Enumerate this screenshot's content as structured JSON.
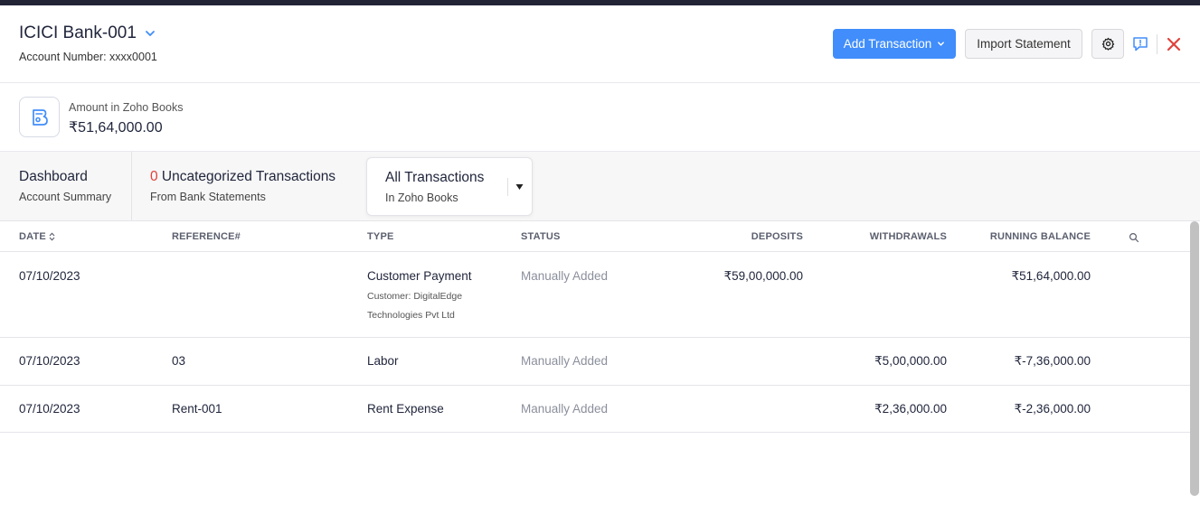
{
  "header": {
    "account_name": "ICICI Bank-001",
    "account_number": "Account Number: xxxx0001",
    "add_transaction_label": "Add Transaction",
    "import_statement_label": "Import Statement"
  },
  "amount": {
    "label": "Amount in Zoho Books",
    "value": "₹51,64,000.00"
  },
  "tabs": {
    "dashboard": {
      "title": "Dashboard",
      "subtitle": "Account Summary"
    },
    "uncategorized": {
      "count": "0",
      "title": " Uncategorized Transactions",
      "subtitle": "From Bank Statements"
    },
    "all": {
      "title": "All Transactions",
      "subtitle": "In Zoho Books"
    }
  },
  "table": {
    "columns": {
      "date": "DATE",
      "reference": "REFERENCE#",
      "type": "TYPE",
      "status": "STATUS",
      "deposits": "DEPOSITS",
      "withdrawals": "WITHDRAWALS",
      "running_balance": "RUNNING BALANCE"
    },
    "rows": [
      {
        "date": "07/10/2023",
        "reference": "",
        "type": "Customer Payment",
        "detail_line1": "Customer: DigitalEdge",
        "detail_line2": "Technologies Pvt Ltd",
        "status": "Manually Added",
        "deposits": "₹59,00,000.00",
        "withdrawals": "",
        "running_balance": "₹51,64,000.00"
      },
      {
        "date": "07/10/2023",
        "reference": "03",
        "type": "Labor",
        "status": "Manually Added",
        "deposits": "",
        "withdrawals": "₹5,00,000.00",
        "running_balance": "₹-7,36,000.00"
      },
      {
        "date": "07/10/2023",
        "reference": "Rent-001",
        "type": "Rent Expense",
        "status": "Manually Added",
        "deposits": "",
        "withdrawals": "₹2,36,000.00",
        "running_balance": "₹-2,36,000.00"
      }
    ]
  },
  "colors": {
    "primary": "#408dfb",
    "danger": "#e0413a",
    "status_text": "#8b8f9c",
    "topbar": "#232336"
  },
  "icons": [
    "chevron-down-icon",
    "caret-down-icon",
    "gear-icon",
    "feedback-icon",
    "close-icon",
    "zoho-books-logo-icon",
    "sort-icon",
    "search-icon"
  ]
}
